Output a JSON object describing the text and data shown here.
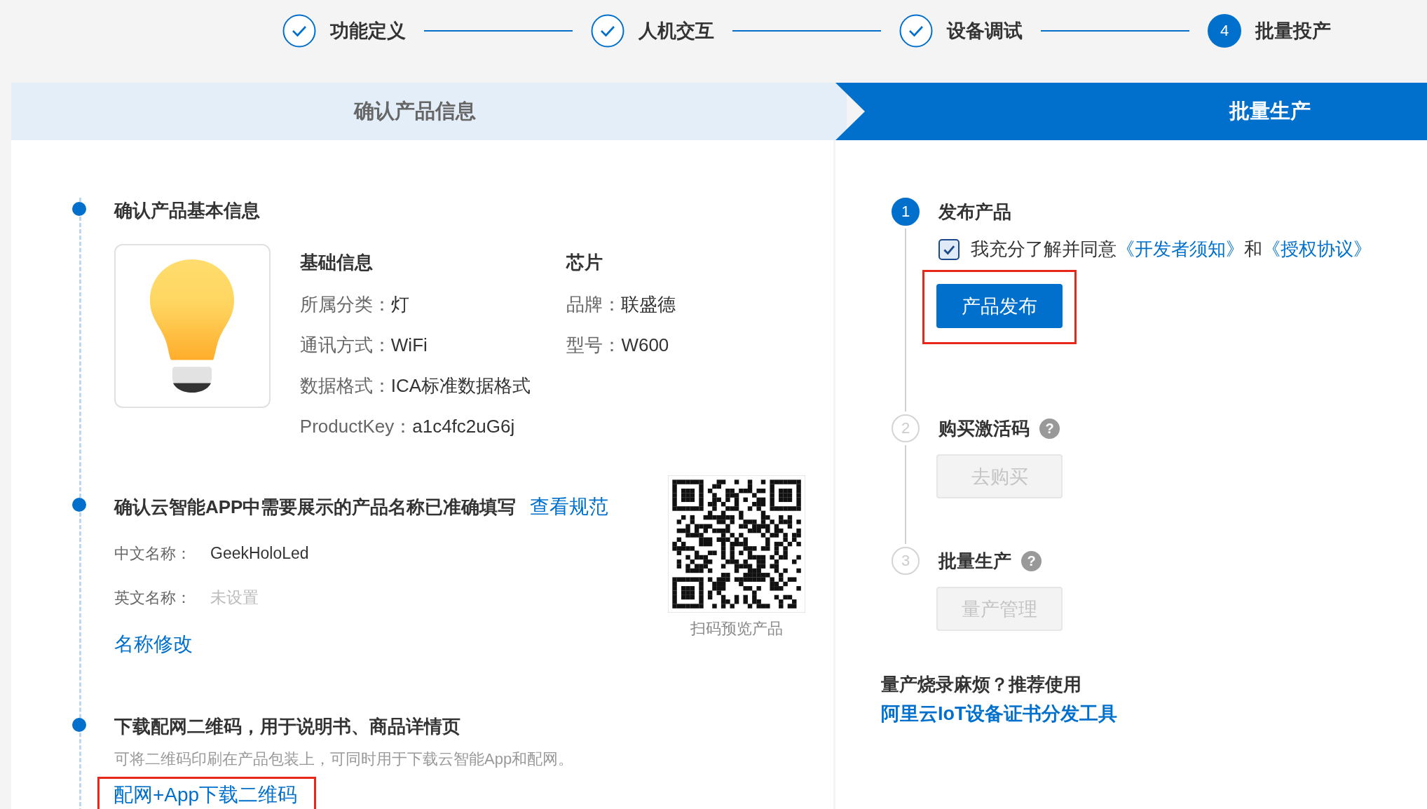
{
  "stepper": [
    {
      "label": "功能定义",
      "done": true
    },
    {
      "label": "人机交互",
      "done": true
    },
    {
      "label": "设备调试",
      "done": true
    },
    {
      "label": "批量投产",
      "done": false,
      "number": "4"
    }
  ],
  "phase_tabs": [
    {
      "label": "确认产品信息",
      "selected": false
    },
    {
      "label": "批量生产",
      "selected": true
    }
  ],
  "product_info": {
    "title": "确认产品基本信息",
    "columns": [
      {
        "heading": "基础信息",
        "fields": [
          {
            "label": "所属分类：",
            "value": "灯"
          },
          {
            "label": "通讯方式：",
            "value": "WiFi"
          },
          {
            "label": "数据格式：",
            "value": "ICA标准数据格式"
          },
          {
            "label": "ProductKey：",
            "value": "a1c4fc2uG6j"
          }
        ]
      },
      {
        "heading": "芯片",
        "fields": [
          {
            "label": "品牌：",
            "value": "联盛德"
          },
          {
            "label": "型号：",
            "value": "W600"
          }
        ]
      }
    ]
  },
  "app_name": {
    "title": "确认云智能APP中需要展示的产品名称已准确填写",
    "link": "查看规范",
    "fields": [
      {
        "label": "中文名称：",
        "value": "GeekHoloLed"
      },
      {
        "label": "英文名称：",
        "placeholder": "未设置"
      }
    ],
    "edit_link": "名称修改",
    "qr_caption": "扫码预览产品"
  },
  "download": {
    "title": "下载配网二维码，用于说明书、商品详情页",
    "description": "可将二维码印刷在产品包装上，可同时用于下载云智能App和配网。",
    "link": "配网+App下载二维码",
    "highlighted": true
  },
  "release_steps": [
    {
      "number": "1",
      "title": "发布产品",
      "active": true,
      "agreement": {
        "checked": true,
        "text": "我充分了解并同意",
        "link_1": "《开发者须知》",
        "joiner": "和",
        "link_2": "《授权协议》"
      },
      "button": {
        "label": "产品发布",
        "disabled": false,
        "highlighted": true
      }
    },
    {
      "number": "2",
      "title": "购买激活码",
      "active": false,
      "help": "?",
      "button": {
        "label": "去购买",
        "disabled": true
      }
    },
    {
      "number": "3",
      "title": "批量生产",
      "active": false,
      "help": "?",
      "button": {
        "label": "量产管理",
        "disabled": true
      }
    }
  ],
  "tool_promo": {
    "text": "量产烧录麻烦？推荐使用",
    "link": "阿里云IoT设备证书分发工具"
  }
}
